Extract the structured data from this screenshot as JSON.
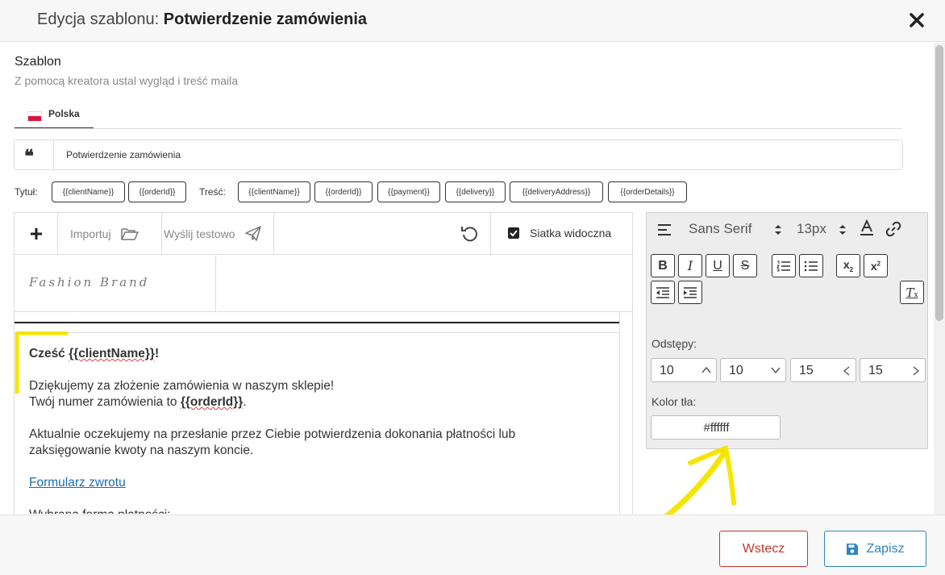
{
  "modal": {
    "title_prefix": "Edycja szablonu:",
    "title_name": "Potwierdzenie zamówienia"
  },
  "section": {
    "title": "Szablon",
    "subtitle": "Z pomocą kreatora ustal wygląd i treść maila"
  },
  "language_tab": {
    "label": "Polska",
    "flag_icon": "poland-flag-icon"
  },
  "subject": {
    "value": "Potwierdzenie zamówienia",
    "icon": "quote-icon"
  },
  "variables": {
    "title_label": "Tytuł:",
    "title_vars": [
      "{{clientName}}",
      "{{orderId}}"
    ],
    "body_label": "Treść:",
    "body_vars": [
      "{{clientName}}",
      "{{orderId}}",
      "{{payment}}",
      "{{delivery}}",
      "{{deliveryAddress}}",
      "{{orderDetails}}"
    ]
  },
  "toolbar": {
    "import_label": "Importuj",
    "send_test_label": "Wyślij testowo",
    "grid_label": "Siatka widoczna",
    "grid_checked": true
  },
  "canvas": {
    "logo_text": "Fashion Brand",
    "greeting_prefix": "Cześć ",
    "greeting_var": "{{clientName}}",
    "greeting_suffix": "!",
    "thanks": "Dziękujemy za złożenie zamówienia w naszym sklepie!",
    "order_prefix": "Twój numer zamówienia to ",
    "order_var": "{{orderId}}",
    "order_suffix": ".",
    "waiting_line1": "Aktualnie oczekujemy na przesłanie przez Ciebie potwierdzenia dokonania płatności lub",
    "waiting_line2": "zaksięgowanie kwoty na naszym koncie.",
    "return_link": "Formularz zwrotu",
    "payment_partial": "Wybrana forma płatności:"
  },
  "properties": {
    "font_family": "Sans Serif",
    "font_size": "13px",
    "spacing_label": "Odstępy:",
    "spacing_values": [
      "10",
      "10",
      "15",
      "15"
    ],
    "bg_label": "Kolor tła:",
    "bg_value": "#ffffff"
  },
  "footer": {
    "back_label": "Wstecz",
    "save_label": "Zapisz"
  },
  "colors": {
    "danger": "#c0392b",
    "primary": "#2e86c1",
    "highlight_marker": "#f5e600",
    "link": "#1a6ea8"
  }
}
